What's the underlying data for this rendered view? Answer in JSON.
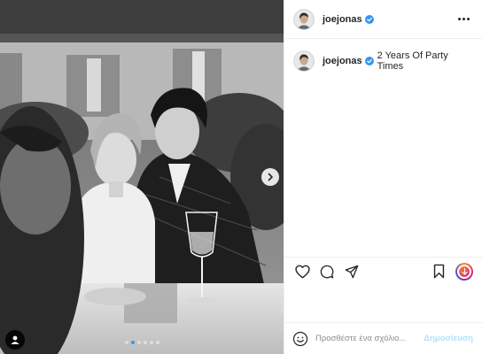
{
  "post": {
    "username": "joejonas",
    "verified": true,
    "caption_text": "2 Years Of Party Times",
    "carousel": {
      "total": 6,
      "active_index": 1
    }
  },
  "comment": {
    "placeholder": "Προσθέστε ένα σχόλιο...",
    "post_label": "Δημοσίευση"
  },
  "icons": {
    "header_more": "more-horizontal-icon",
    "verified": "verified-badge-icon",
    "like": "heart-icon",
    "comment": "comment-icon",
    "share": "paper-plane-icon",
    "save": "bookmark-icon",
    "story": "story-ring-icon",
    "emoji": "smiley-icon",
    "tag": "user-tag-icon",
    "next": "chevron-right-icon"
  },
  "colors": {
    "verified_blue": "#3897f0",
    "post_button_disabled": "#b2dffc",
    "text_primary": "#262626",
    "text_secondary": "#8e8e8e",
    "divider": "#efefef"
  }
}
